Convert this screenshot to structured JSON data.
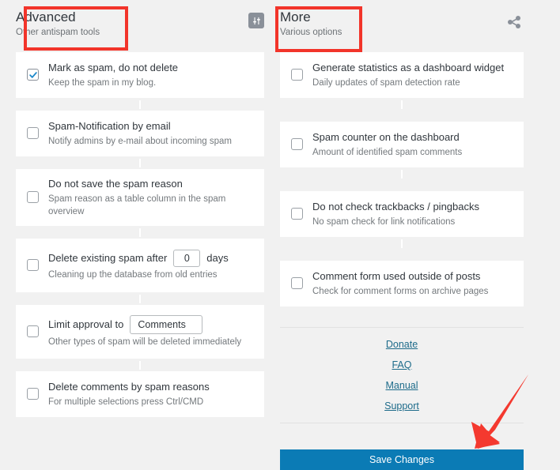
{
  "sections": {
    "left": {
      "title": "Advanced",
      "subtitle": "Other antispam tools",
      "icon": "sliders-icon",
      "options": [
        {
          "title": "Mark as spam, do not delete",
          "subtitle": "Keep the spam in my blog.",
          "checked": true
        },
        {
          "title": "Spam-Notification by email",
          "subtitle": "Notify admins by e-mail about incoming spam",
          "checked": false
        },
        {
          "title": "Do not save the spam reason",
          "subtitle": "Spam reason as a table column in the spam overview",
          "checked": false
        },
        {
          "title_before": "Delete existing spam after",
          "title_after": "days",
          "input_value": "0",
          "subtitle": "Cleaning up the database from old entries",
          "checked": false
        },
        {
          "title_before": "Limit approval to",
          "input_value": "Comments",
          "subtitle": "Other types of spam will be deleted immediately",
          "checked": false
        },
        {
          "title": "Delete comments by spam reasons",
          "subtitle": "For multiple selections press Ctrl/CMD",
          "checked": false
        }
      ]
    },
    "right": {
      "title": "More",
      "subtitle": "Various options",
      "icon": "share-icon",
      "options": [
        {
          "title": "Generate statistics as a dashboard widget",
          "subtitle": "Daily updates of spam detection rate",
          "checked": false
        },
        {
          "title": "Spam counter on the dashboard",
          "subtitle": "Amount of identified spam comments",
          "checked": false
        },
        {
          "title": "Do not check trackbacks / pingbacks",
          "subtitle": "No spam check for link notifications",
          "checked": false
        },
        {
          "title": "Comment form used outside of posts",
          "subtitle": "Check for comment forms on archive pages",
          "checked": false
        }
      ],
      "links": [
        {
          "label": "Donate"
        },
        {
          "label": "FAQ"
        },
        {
          "label": "Manual"
        },
        {
          "label": "Support"
        }
      ],
      "save_label": "Save Changes"
    }
  },
  "colors": {
    "accent_blue": "#0b7bb5",
    "link_blue": "#1d6b8a",
    "annotation_red": "#f2342a",
    "page_bg": "#f1f1f1",
    "card_bg": "#ffffff",
    "icon_grey": "#8a9099"
  }
}
